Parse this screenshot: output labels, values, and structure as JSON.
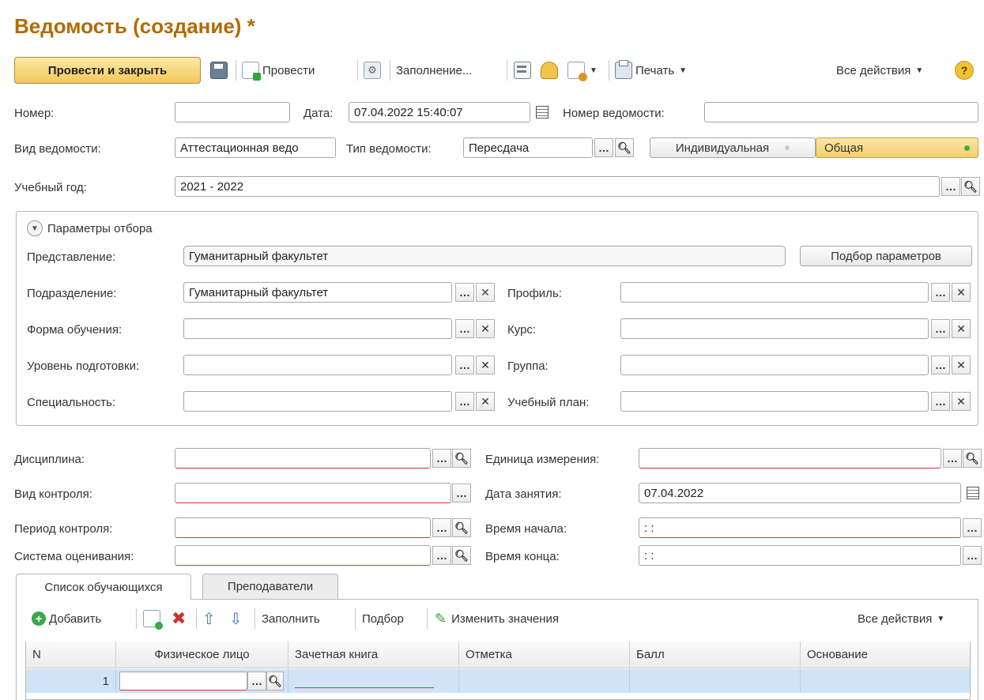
{
  "title": "Ведомость (создание) *",
  "toolbar": {
    "post_close": "Провести и закрыть",
    "post": "Провести",
    "fill": "Заполнение...",
    "print": "Печать",
    "all_actions": "Все действия",
    "help": "?"
  },
  "form": {
    "number_label": "Номер:",
    "number_value": "",
    "date_label": "Дата:",
    "date_value": "07.04.2022 15:40:07",
    "sheet_number_label": "Номер ведомости:",
    "sheet_number_value": "",
    "sheet_kind_label": "Вид ведомости:",
    "sheet_kind_value": "Аттестационная ведо",
    "sheet_type_label": "Тип ведомости:",
    "sheet_type_value": "Пересдача",
    "mode_individual": "Индивидуальная",
    "mode_general": "Общая",
    "year_label": "Учебный год:",
    "year_value": "2021 - 2022"
  },
  "filter": {
    "header": "Параметры отбора",
    "repr_label": "Представление:",
    "repr_value": "Гуманитарный факультет",
    "pick_button": "Подбор параметров",
    "dept_label": "Подразделение:",
    "dept_value": "Гуманитарный факультет",
    "profile_label": "Профиль:",
    "profile_value": "",
    "study_form_label": "Форма обучения:",
    "study_form_value": "",
    "course_label": "Курс:",
    "course_value": "",
    "level_label": "Уровень подготовки:",
    "level_value": "",
    "group_label": "Группа:",
    "group_value": "",
    "specialty_label": "Специальность:",
    "specialty_value": "",
    "plan_label": "Учебный план:",
    "plan_value": ""
  },
  "details": {
    "discipline_label": "Дисциплина:",
    "discipline_value": "",
    "unit_label": "Единица измерения:",
    "unit_value": "",
    "control_kind_label": "Вид контроля:",
    "control_kind_value": "",
    "lesson_date_label": "Дата занятия:",
    "lesson_date_value": "07.04.2022",
    "control_period_label": "Период контроля:",
    "control_period_value": "",
    "start_time_label": "Время начала:",
    "start_time_value": " : :",
    "grading_label": "Система оценивания:",
    "grading_value": "",
    "end_time_label": "Время конца:",
    "end_time_value": " : :"
  },
  "tabs": [
    {
      "label": "Список обучающихся"
    },
    {
      "label": "Преподаватели"
    }
  ],
  "table_toolbar": {
    "add": "Добавить",
    "fill": "Заполнить",
    "pick": "Подбор",
    "change_values": "Изменить значения",
    "all_actions": "Все действия"
  },
  "table": {
    "columns": [
      "N",
      "Физическое лицо",
      "Зачетная книга",
      "Отметка",
      "Балл",
      "Основание"
    ],
    "rows": [
      {
        "n": "1",
        "person": "",
        "book": "",
        "mark": "",
        "score": "",
        "basis": ""
      }
    ]
  },
  "colors": {
    "title": "#b36b00",
    "primary_button": "#f4c85a",
    "selected_row": "#cfe4f7",
    "required_underline": "#dd3333"
  }
}
